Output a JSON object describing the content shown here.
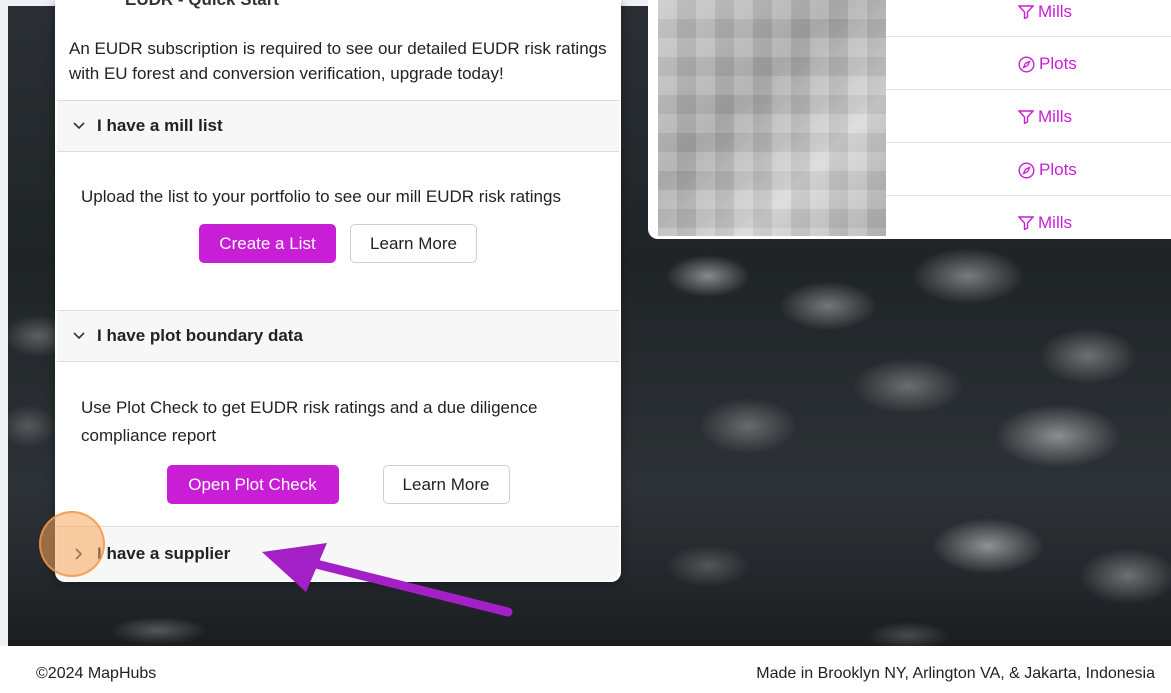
{
  "card": {
    "title": "EUDR - Quick Start",
    "intro": "An EUDR subscription is required to see our detailed EUDR risk ratings with EU forest and conversion verification, upgrade today!",
    "sections": [
      {
        "title": "I have a mill list",
        "body": "Upload the list to your portfolio to see our mill EUDR risk ratings",
        "primary": "Create a List",
        "secondary": "Learn More"
      },
      {
        "title": "I have plot boundary data",
        "body": "Use Plot Check to get EUDR risk ratings and a due diligence compliance report",
        "primary": "Open Plot Check",
        "secondary": "Learn More"
      },
      {
        "title": "I have a supplier"
      }
    ]
  },
  "table": {
    "links": [
      {
        "label": "Mills",
        "icon": "funnel-icon"
      },
      {
        "label": "Plots",
        "icon": "compass-icon"
      },
      {
        "label": "Mills",
        "icon": "funnel-icon"
      },
      {
        "label": "Plots",
        "icon": "compass-icon"
      },
      {
        "label": "Mills",
        "icon": "funnel-icon"
      }
    ]
  },
  "footer": {
    "copyright": "©2024 MapHubs",
    "made_in": "Made in Brooklyn NY, Arlington VA, & Jakarta, Indonesia"
  },
  "colors": {
    "accent": "#c81fd6",
    "arrow": "#a31fc6",
    "click_marker": "#f7a55a"
  }
}
